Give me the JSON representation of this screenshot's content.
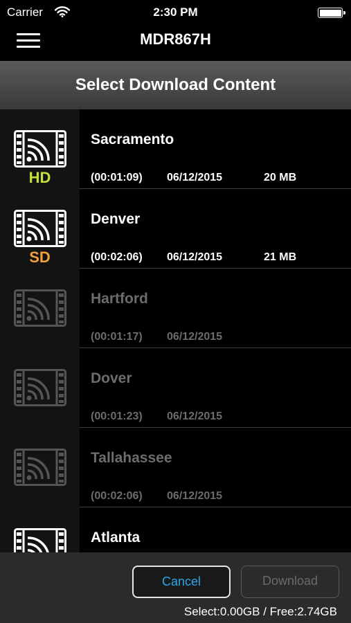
{
  "status_bar": {
    "carrier": "Carrier",
    "time": "2:30 PM"
  },
  "nav": {
    "title": "MDR867H"
  },
  "section": {
    "title": "Select Download Content"
  },
  "items": [
    {
      "title": "Sacramento",
      "duration": "(00:01:09)",
      "date": "06/12/2015",
      "size": "20 MB",
      "quality": "HD",
      "enabled": true
    },
    {
      "title": "Denver",
      "duration": "(00:02:06)",
      "date": "06/12/2015",
      "size": "21 MB",
      "quality": "SD",
      "enabled": true
    },
    {
      "title": "Hartford",
      "duration": "(00:01:17)",
      "date": "06/12/2015",
      "size": "",
      "quality": "",
      "enabled": false
    },
    {
      "title": "Dover",
      "duration": "(00:01:23)",
      "date": "06/12/2015",
      "size": "",
      "quality": "",
      "enabled": false
    },
    {
      "title": "Tallahassee",
      "duration": "(00:02:06)",
      "date": "06/12/2015",
      "size": "",
      "quality": "",
      "enabled": false
    },
    {
      "title": "Atlanta",
      "duration": "",
      "date": "",
      "size": "",
      "quality": "",
      "enabled": true
    }
  ],
  "footer": {
    "cancel_label": "Cancel",
    "download_label": "Download",
    "storage": "Select:0.00GB / Free:2.74GB"
  },
  "icons": {
    "thumbnail": "video-film-icon",
    "menu": "menu-icon",
    "wifi": "wifi-icon",
    "battery": "battery-icon"
  },
  "colors": {
    "hd": "#c3e233",
    "sd": "#f0a23a",
    "cancel_text": "#2aa8e8"
  }
}
